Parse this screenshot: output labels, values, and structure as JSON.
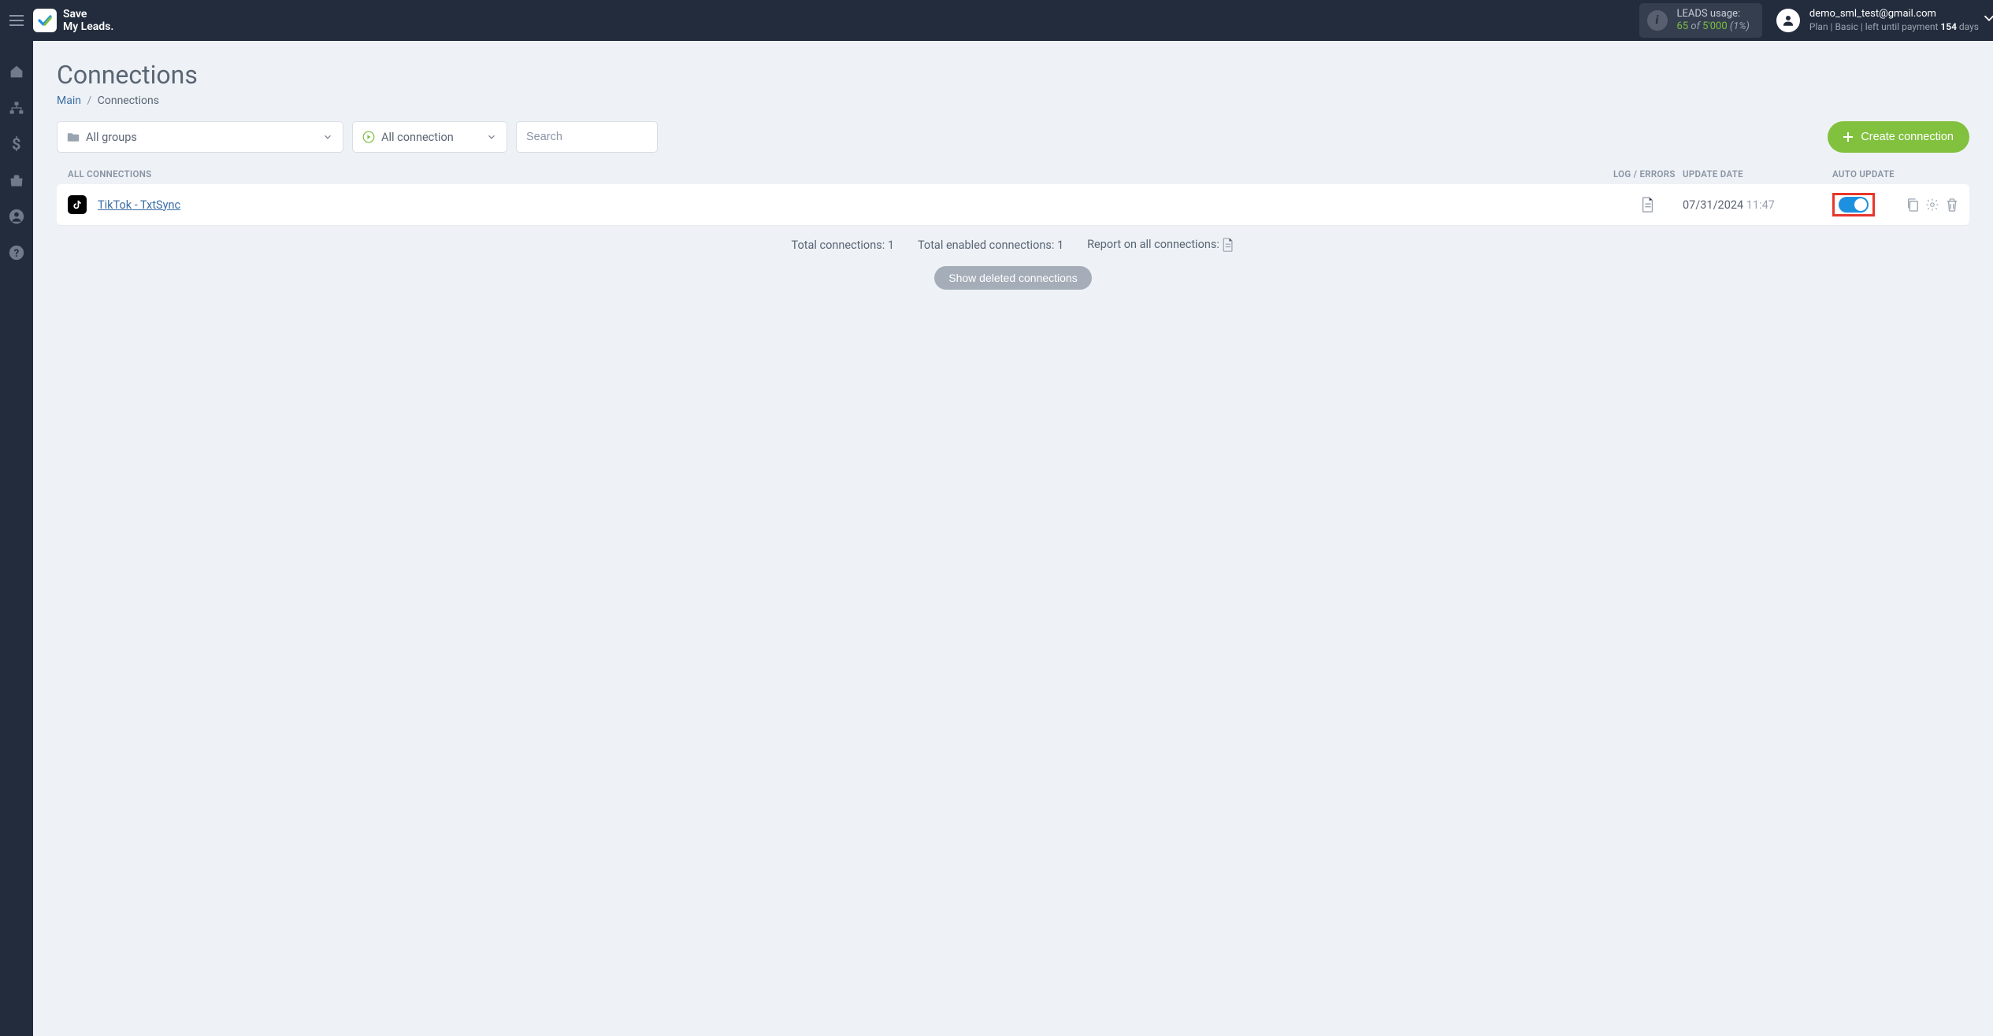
{
  "header": {
    "logo_line1": "Save",
    "logo_line2": "My Leads.",
    "usage_label": "LEADS usage:",
    "usage_current": "65",
    "usage_of": "of",
    "usage_max": "5'000",
    "usage_pct": "(1%)",
    "account_email": "demo_sml_test@gmail.com",
    "plan_prefix": "Plan ",
    "plan_name": "| Basic |",
    "plan_mid": " left until payment ",
    "plan_days": "154",
    "plan_suffix": " days"
  },
  "page": {
    "title": "Connections",
    "breadcrumb_main": "Main",
    "breadcrumb_current": "Connections"
  },
  "toolbar": {
    "groups_label": "All groups",
    "connection_label": "All connection",
    "search_placeholder": "Search",
    "create_label": "Create connection"
  },
  "list": {
    "header_all": "ALL CONNECTIONS",
    "header_log": "LOG / ERRORS",
    "header_date": "UPDATE DATE",
    "header_auto": "AUTO UPDATE",
    "rows": [
      {
        "name": "TikTok - TxtSync",
        "date": "07/31/2024",
        "time": "11:47"
      }
    ]
  },
  "summary": {
    "total_label": "Total connections: ",
    "total_value": "1",
    "enabled_label": "Total enabled connections: ",
    "enabled_value": "1",
    "report_label": "Report on all connections: ",
    "show_deleted": "Show deleted connections"
  }
}
